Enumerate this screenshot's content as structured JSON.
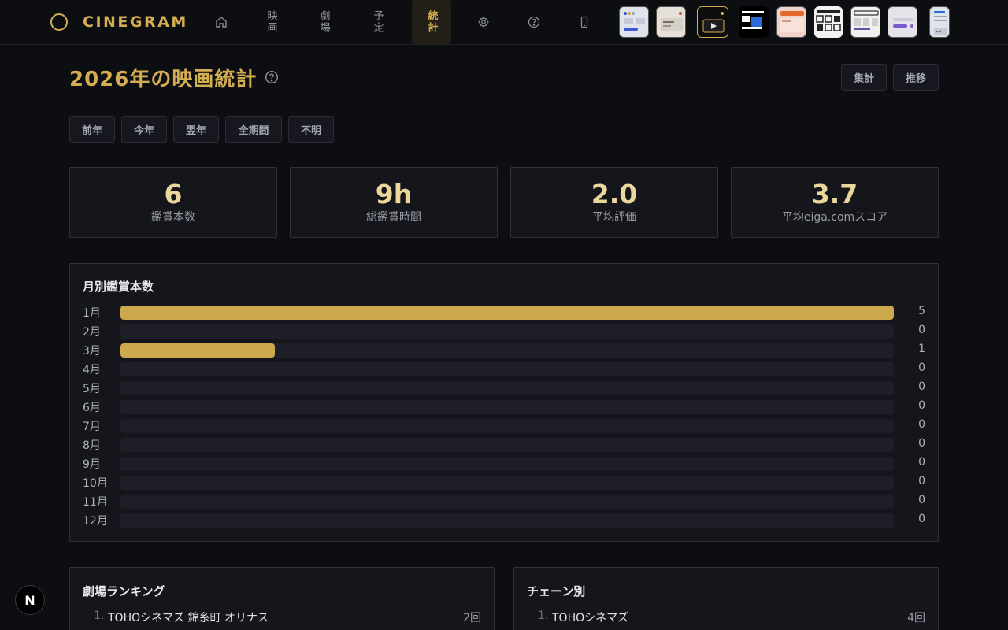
{
  "app": {
    "logo_text": "CINEGRAM"
  },
  "nav": {
    "items": [
      {
        "label": "映画",
        "active": false
      },
      {
        "label": "劇場",
        "active": false
      },
      {
        "label": "予定",
        "active": false
      },
      {
        "label": "統計",
        "active": true
      }
    ],
    "icons": [
      "home-icon",
      "gear-icon",
      "help-circle-icon",
      "smartphone-icon"
    ],
    "theme_thumbnails": [
      "theme-dashboard",
      "theme-document",
      "theme-player",
      "theme-dark-blocks",
      "theme-peach",
      "theme-grid",
      "theme-list",
      "theme-pills",
      "theme-mobile"
    ]
  },
  "page": {
    "title": "2026年の映画統計",
    "view_buttons": {
      "summary": "集計",
      "trend": "推移"
    },
    "year_filters": [
      "前年",
      "今年",
      "翌年",
      "全期間",
      "不明"
    ]
  },
  "stats": [
    {
      "value": "6",
      "label": "鑑賞本数"
    },
    {
      "value": "9h",
      "label": "総鑑賞時間"
    },
    {
      "value": "2.0",
      "label": "平均評価"
    },
    {
      "value": "3.7",
      "label": "平均eiga.comスコア"
    }
  ],
  "monthly": {
    "title": "月別鑑賞本数",
    "max": 5
  },
  "chart_data": {
    "type": "bar",
    "title": "月別鑑賞本数",
    "orientation": "horizontal",
    "categories": [
      "1月",
      "2月",
      "3月",
      "4月",
      "5月",
      "6月",
      "7月",
      "8月",
      "9月",
      "10月",
      "11月",
      "12月"
    ],
    "values": [
      5,
      0,
      1,
      0,
      0,
      0,
      0,
      0,
      0,
      0,
      0,
      0
    ],
    "xlim": [
      0,
      5
    ],
    "colors": {
      "bar": "#cca94c",
      "track": "#1d1e27"
    }
  },
  "theater_ranking": {
    "title": "劇場ランキング",
    "items": [
      {
        "rank": "1.",
        "name": "TOHOシネマズ 錦糸町 オリナス",
        "count": "2回"
      }
    ]
  },
  "chain_ranking": {
    "title": "チェーン別",
    "items": [
      {
        "rank": "1.",
        "name": "TOHOシネマズ",
        "count": "4回"
      }
    ]
  },
  "badge": {
    "label": "N"
  },
  "colors": {
    "accent": "#d3ad52",
    "background": "#0d0e12",
    "card": "#15161c"
  }
}
